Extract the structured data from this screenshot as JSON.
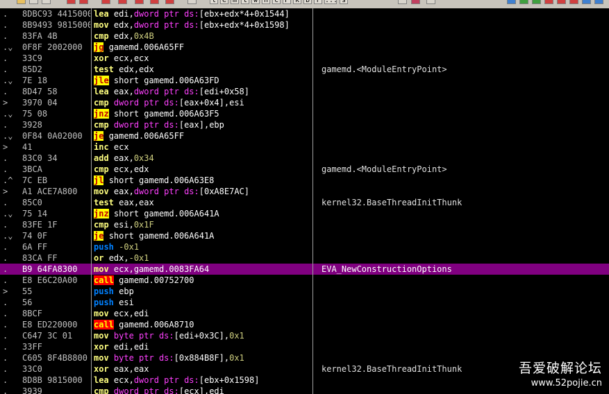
{
  "toolbar": {
    "letters": [
      "l",
      "e",
      "m",
      "t",
      "w",
      "h",
      "c",
      "P",
      "k",
      "b",
      "r",
      "...",
      "s"
    ]
  },
  "rows": [
    {
      "arrow": ".",
      "hex": "8DBC93 4415000",
      "mn": "lea",
      "cls": "m-lea",
      "ops": [
        {
          "t": "edi,",
          "c": "op"
        },
        {
          "t": "dword ptr ds:",
          "c": "kw"
        },
        {
          "t": "[ebx+edx*4+0x1544]",
          "c": "op"
        }
      ],
      "comment": ""
    },
    {
      "arrow": ".",
      "hex": "8B9493 9815000",
      "mn": "mov",
      "cls": "m-mov",
      "ops": [
        {
          "t": "edx,",
          "c": "op"
        },
        {
          "t": "dword ptr ds:",
          "c": "kw"
        },
        {
          "t": "[ebx+edx*4+0x1598]",
          "c": "op"
        }
      ],
      "comment": ""
    },
    {
      "arrow": ".",
      "hex": "83FA 4B",
      "mn": "cmp",
      "cls": "m-cmp",
      "ops": [
        {
          "t": "edx,",
          "c": "op"
        },
        {
          "t": "0x4B",
          "c": "num"
        }
      ],
      "comment": ""
    },
    {
      "arrow": ".⌄",
      "hex": "0F8F 2002000",
      "mn": "jg",
      "cls": "m-jmp",
      "ops": [
        {
          "t": "gamemd.006A65FF",
          "c": "op"
        }
      ],
      "comment": ""
    },
    {
      "arrow": ".",
      "hex": "33C9",
      "mn": "xor",
      "cls": "m-xor",
      "ops": [
        {
          "t": "ecx,ecx",
          "c": "op"
        }
      ],
      "comment": ""
    },
    {
      "arrow": ".",
      "hex": "85D2",
      "mn": "test",
      "cls": "m-test",
      "ops": [
        {
          "t": "edx,edx",
          "c": "op"
        }
      ],
      "comment": "gamemd.<ModuleEntryPoint>"
    },
    {
      "arrow": ".⌄",
      "hex": "7E 18",
      "mn": "jle",
      "cls": "m-jmp",
      "ops": [
        {
          "t": "short gamemd.006A63FD",
          "c": "op"
        }
      ],
      "comment": ""
    },
    {
      "arrow": ".",
      "hex": "8D47 58",
      "mn": "lea",
      "cls": "m-lea",
      "ops": [
        {
          "t": "eax,",
          "c": "op"
        },
        {
          "t": "dword ptr ds:",
          "c": "kw"
        },
        {
          "t": "[edi+0x58]",
          "c": "op"
        }
      ],
      "comment": ""
    },
    {
      "arrow": ">",
      "hex": "3970 04",
      "mn": "cmp",
      "cls": "m-cmp",
      "ops": [
        {
          "t": "dword ptr ds:",
          "c": "kw"
        },
        {
          "t": "[eax+0x4],esi",
          "c": "op"
        }
      ],
      "comment": ""
    },
    {
      "arrow": ".⌄",
      "hex": "75 08",
      "mn": "jnz",
      "cls": "m-jmp",
      "ops": [
        {
          "t": "short gamemd.006A63F5",
          "c": "op"
        }
      ],
      "comment": ""
    },
    {
      "arrow": ".",
      "hex": "3928",
      "mn": "cmp",
      "cls": "m-cmp",
      "ops": [
        {
          "t": "dword ptr ds:",
          "c": "kw"
        },
        {
          "t": "[eax],ebp",
          "c": "op"
        }
      ],
      "comment": ""
    },
    {
      "arrow": ".⌄",
      "hex": "0F84 0A02000",
      "mn": "je",
      "cls": "m-jmp",
      "ops": [
        {
          "t": "gamemd.006A65FF",
          "c": "op"
        }
      ],
      "comment": ""
    },
    {
      "arrow": ">",
      "hex": "41",
      "mn": "inc",
      "cls": "m-inc",
      "ops": [
        {
          "t": "ecx",
          "c": "op"
        }
      ],
      "comment": ""
    },
    {
      "arrow": ".",
      "hex": "83C0 34",
      "mn": "add",
      "cls": "m-add",
      "ops": [
        {
          "t": "eax,",
          "c": "op"
        },
        {
          "t": "0x34",
          "c": "num"
        }
      ],
      "comment": ""
    },
    {
      "arrow": ".",
      "hex": "3BCA",
      "mn": "cmp",
      "cls": "m-cmp",
      "ops": [
        {
          "t": "ecx,edx",
          "c": "op"
        }
      ],
      "comment": "gamemd.<ModuleEntryPoint>"
    },
    {
      "arrow": ".^",
      "hex": "7C EB",
      "mn": "jl",
      "cls": "m-jmp",
      "ops": [
        {
          "t": "short gamemd.006A63E8",
          "c": "op"
        }
      ],
      "comment": ""
    },
    {
      "arrow": ">",
      "hex": "A1 ACE7A800",
      "mn": "mov",
      "cls": "m-mov",
      "ops": [
        {
          "t": "eax,",
          "c": "op"
        },
        {
          "t": "dword ptr ds:",
          "c": "kw"
        },
        {
          "t": "[0xA8E7AC]",
          "c": "op"
        }
      ],
      "comment": ""
    },
    {
      "arrow": ".",
      "hex": "85C0",
      "mn": "test",
      "cls": "m-test",
      "ops": [
        {
          "t": "eax,eax",
          "c": "op"
        }
      ],
      "comment": "kernel32.BaseThreadInitThunk"
    },
    {
      "arrow": ".⌄",
      "hex": "75 14",
      "mn": "jnz",
      "cls": "m-jmp",
      "ops": [
        {
          "t": "short gamemd.006A641A",
          "c": "op"
        }
      ],
      "comment": ""
    },
    {
      "arrow": ".",
      "hex": "83FE 1F",
      "mn": "cmp",
      "cls": "m-cmp",
      "ops": [
        {
          "t": "esi,",
          "c": "op"
        },
        {
          "t": "0x1F",
          "c": "num"
        }
      ],
      "comment": ""
    },
    {
      "arrow": ".⌄",
      "hex": "74 0F",
      "mn": "je",
      "cls": "m-jmp",
      "ops": [
        {
          "t": "short gamemd.006A641A",
          "c": "op"
        }
      ],
      "comment": ""
    },
    {
      "arrow": ".",
      "hex": "6A FF",
      "mn": "push",
      "cls": "m-push",
      "ops": [
        {
          "t": "-0x1",
          "c": "num"
        }
      ],
      "comment": ""
    },
    {
      "arrow": ".",
      "hex": "83CA FF",
      "mn": "or",
      "cls": "m-or",
      "ops": [
        {
          "t": "edx,",
          "c": "op"
        },
        {
          "t": "-0x1",
          "c": "num"
        }
      ],
      "comment": ""
    },
    {
      "arrow": ".",
      "hex": "B9 64FA8300",
      "mn": "mov",
      "cls": "m-mov",
      "ops": [
        {
          "t": "ecx,gamemd.0083FA64",
          "c": "op"
        }
      ],
      "comment": "EVA_NewConstructionOptions",
      "selected": true
    },
    {
      "arrow": ".",
      "hex": "E8 E6C20A00",
      "mn": "call",
      "cls": "m-call",
      "ops": [
        {
          "t": "gamemd.00752700",
          "c": "op"
        }
      ],
      "comment": ""
    },
    {
      "arrow": ">",
      "hex": "55",
      "mn": "push",
      "cls": "m-push",
      "ops": [
        {
          "t": "ebp",
          "c": "op"
        }
      ],
      "comment": ""
    },
    {
      "arrow": ".",
      "hex": "56",
      "mn": "push",
      "cls": "m-push",
      "ops": [
        {
          "t": "esi",
          "c": "op"
        }
      ],
      "comment": ""
    },
    {
      "arrow": ".",
      "hex": "8BCF",
      "mn": "mov",
      "cls": "m-mov",
      "ops": [
        {
          "t": "ecx,edi",
          "c": "op"
        }
      ],
      "comment": ""
    },
    {
      "arrow": ".",
      "hex": "E8 ED220000",
      "mn": "call",
      "cls": "m-call",
      "ops": [
        {
          "t": "gamemd.006A8710",
          "c": "op"
        }
      ],
      "comment": ""
    },
    {
      "arrow": ".",
      "hex": "C647 3C 01",
      "mn": "mov",
      "cls": "m-mov",
      "ops": [
        {
          "t": "byte ptr ds:",
          "c": "kw"
        },
        {
          "t": "[edi+0x3C],",
          "c": "op"
        },
        {
          "t": "0x1",
          "c": "num"
        }
      ],
      "comment": ""
    },
    {
      "arrow": ".",
      "hex": "33FF",
      "mn": "xor",
      "cls": "m-xor",
      "ops": [
        {
          "t": "edi,edi",
          "c": "op"
        }
      ],
      "comment": ""
    },
    {
      "arrow": ".",
      "hex": "C605 8F4B8800",
      "mn": "mov",
      "cls": "m-mov",
      "ops": [
        {
          "t": "byte ptr ds:",
          "c": "kw"
        },
        {
          "t": "[0x884B8F],",
          "c": "op"
        },
        {
          "t": "0x1",
          "c": "num"
        }
      ],
      "comment": ""
    },
    {
      "arrow": ".",
      "hex": "33C0",
      "mn": "xor",
      "cls": "m-xor",
      "ops": [
        {
          "t": "eax,eax",
          "c": "op"
        }
      ],
      "comment": "kernel32.BaseThreadInitThunk"
    },
    {
      "arrow": ".",
      "hex": "8D8B 9815000",
      "mn": "lea",
      "cls": "m-lea",
      "ops": [
        {
          "t": "ecx,",
          "c": "op"
        },
        {
          "t": "dword ptr ds:",
          "c": "kw"
        },
        {
          "t": "[ebx+0x1598]",
          "c": "op"
        }
      ],
      "comment": ""
    },
    {
      "arrow": ".",
      "hex": "3939",
      "mn": "cmp",
      "cls": "m-cmp",
      "ops": [
        {
          "t": "dword ptr ds:",
          "c": "kw"
        },
        {
          "t": "[ecx],edi",
          "c": "op"
        }
      ],
      "comment": ""
    }
  ],
  "watermark": {
    "title": "吾爱破解论坛",
    "url": "www.52pojie.cn"
  }
}
